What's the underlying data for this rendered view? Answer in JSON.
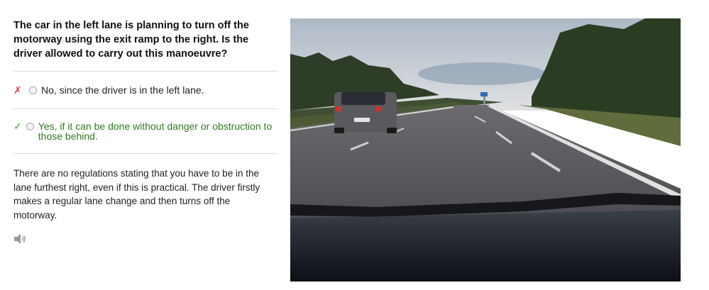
{
  "question": {
    "text": "The car in the left lane is planning to turn off the motorway using the exit ramp to the right. Is the driver allowed to carry out this manoeuvre?"
  },
  "answers": [
    {
      "mark": "✗",
      "text": "No, since the driver is in the left lane.",
      "status": "incorrect"
    },
    {
      "mark": "✓",
      "text": "Yes, if it can be done without danger or obstruction to those behind.",
      "status": "correct"
    }
  ],
  "explanation": {
    "text": "There are no regulations stating that you have to be in the lane furthest right, even if this is practical. The driver firstly makes a regular lane change and then turns off the motorway."
  },
  "icons": {
    "audio": "speaker-icon"
  },
  "colors": {
    "correct": "#2f7a1f",
    "incorrect": "#d9434d"
  }
}
